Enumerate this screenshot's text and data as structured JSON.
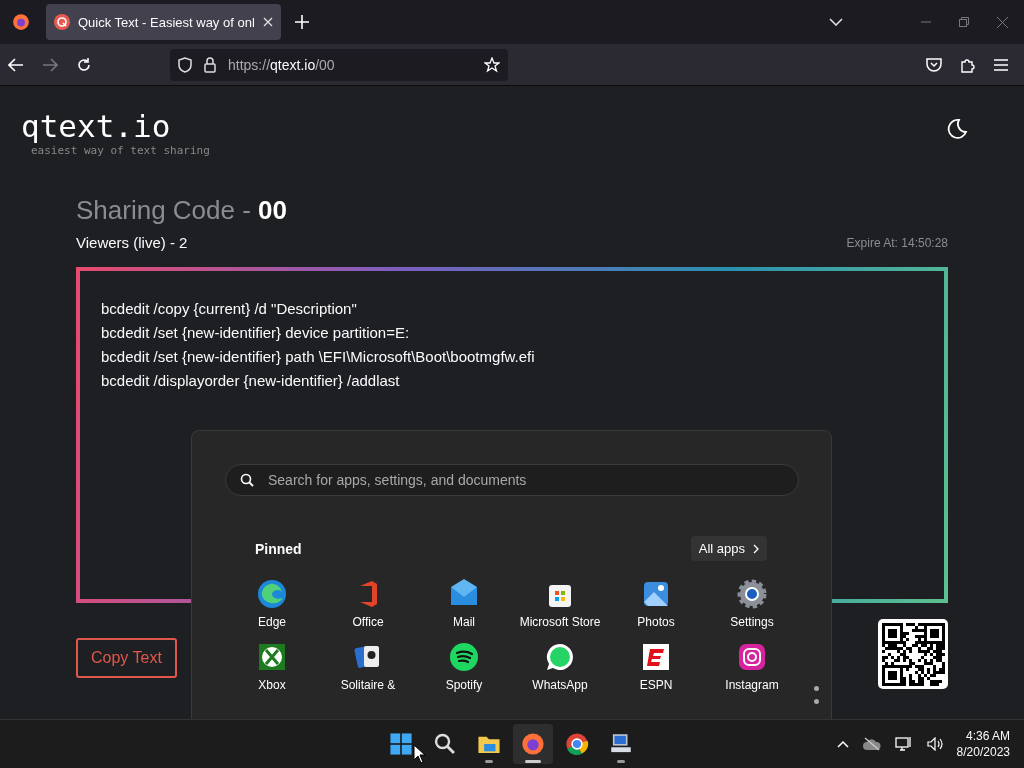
{
  "browser": {
    "tab": {
      "title": "Quick Text - Easiest way of onl",
      "selected": true
    },
    "url": {
      "scheme": "https://",
      "host": "qtext.io",
      "path": "/00"
    }
  },
  "page": {
    "logo": "qtext.io",
    "tagline": "easiest way of text sharing",
    "sharing_code": "Sharing Code - **00**",
    "viewers": "Viewers (live) - 2",
    "expire": "Expire At: 14:50:28",
    "text_lines": [
      "bcdedit /copy {current} /d \"Description\"",
      "bcdedit /set {new-identifier} device partition=E:",
      "bcdedit /set {new-identifier} path \\EFI\\Microsoft\\Boot\\bootmgfw.efi",
      "bcdedit /displayorder {new-identifier} /addlast"
    ],
    "copy_button": "Copy Text"
  },
  "start_menu": {
    "search": {
      "placeholder": "Search for apps, settings, and documents"
    },
    "pinned_title": "Pinned",
    "all_apps": "All apps",
    "apps": [
      "Edge",
      "Office",
      "Mail",
      "Microsoft Store",
      "Photos",
      "Settings",
      "Xbox",
      "Solitaire &",
      "Spotify",
      "WhatsApp",
      "ESPN",
      "Instagram"
    ]
  },
  "taskbar": {
    "items": [
      {
        "running": false,
        "selected": false
      },
      {
        "running": false,
        "selected": false
      },
      {
        "running": true,
        "selected": false
      },
      {
        "running": true,
        "selected": true
      },
      {
        "running": false,
        "selected": false
      },
      {
        "running": true,
        "selected": false
      }
    ],
    "time": "4:36 AM",
    "date": "8/20/2023"
  }
}
